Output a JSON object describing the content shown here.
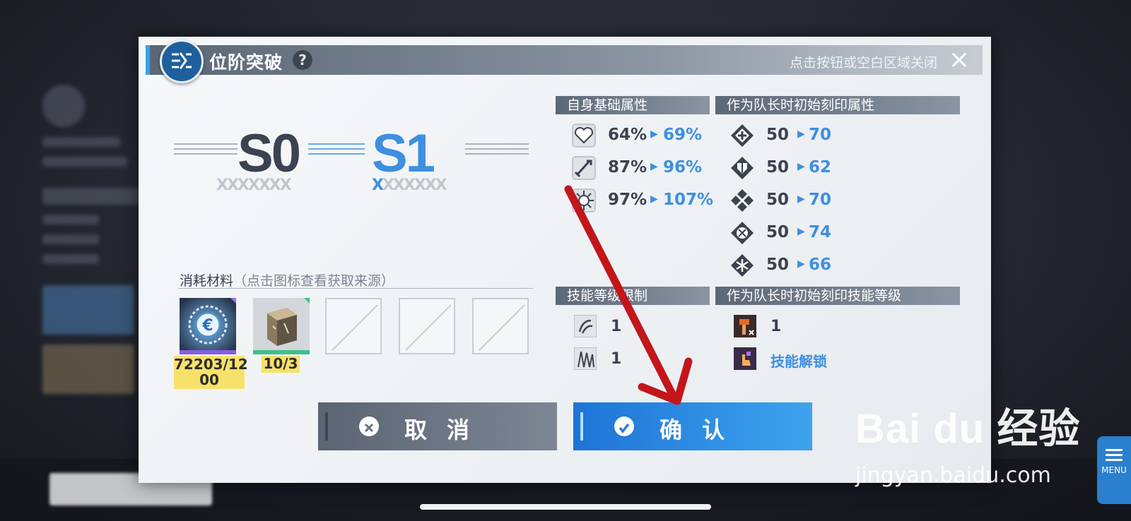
{
  "dialog": {
    "title": "位阶突破",
    "help": "?",
    "close_hint": "点击按钮或空白区域关闭",
    "close_icon": "×"
  },
  "rank": {
    "from": "S0",
    "to": "S1"
  },
  "base_stats": {
    "title": "自身基础属性",
    "rows": [
      {
        "icon": "heart-icon",
        "from": "64%",
        "to": "69%"
      },
      {
        "icon": "sword-icon",
        "from": "87%",
        "to": "96%"
      },
      {
        "icon": "gear-icon",
        "from": "97%",
        "to": "107%"
      }
    ]
  },
  "leader_stats": {
    "title": "作为队长时初始刻印属性",
    "rows": [
      {
        "icon": "cross-shield-icon",
        "from": "50",
        "to": "70"
      },
      {
        "icon": "shield-icon",
        "from": "50",
        "to": "62"
      },
      {
        "icon": "crossed-swords-icon",
        "from": "50",
        "to": "70"
      },
      {
        "icon": "target-icon",
        "from": "50",
        "to": "74"
      },
      {
        "icon": "snowflake-icon",
        "from": "50",
        "to": "66"
      }
    ]
  },
  "materials": {
    "title": "消耗材料",
    "hint": "（点击图标查看获取来源）",
    "items": [
      {
        "icon": "credit-coin-icon",
        "qty_line1": "72203/12",
        "qty_line2": "00"
      },
      {
        "icon": "metal-cube-icon",
        "qty_line1": "10/3"
      }
    ]
  },
  "skill_limits": {
    "title": "技能等级限制",
    "rows": [
      {
        "value": "1"
      },
      {
        "value": "1"
      }
    ]
  },
  "leader_skills": {
    "title": "作为队长时初始刻印技能等级",
    "rows": [
      {
        "value": "1"
      },
      {
        "value": "技能解锁"
      }
    ]
  },
  "buttons": {
    "cancel": "取消",
    "confirm": "确认"
  },
  "menu": {
    "label": "MENU"
  },
  "watermark": {
    "main": "Bai du 经验",
    "sub": "jingyan.baidu.com"
  },
  "colors": {
    "accent": "#3e8fe0",
    "highlight": "#f7e16a",
    "arrow": "#c2161b"
  }
}
